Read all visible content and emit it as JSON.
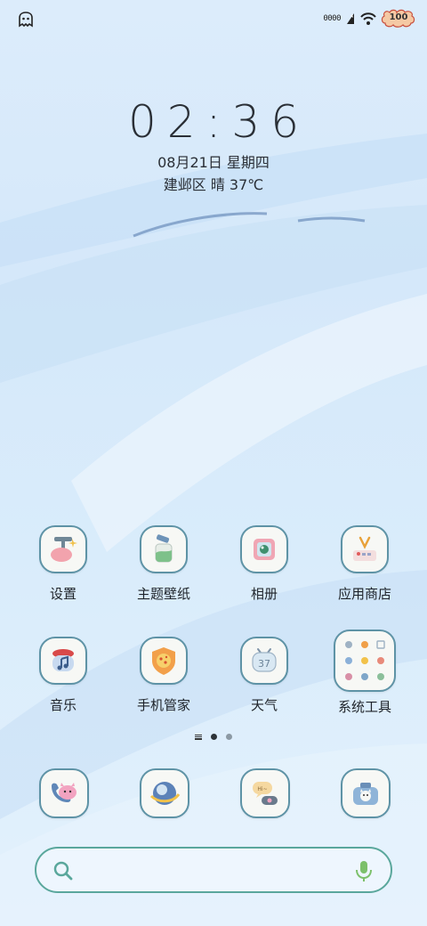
{
  "status_bar": {
    "network_speed": "0000",
    "battery_level": "100",
    "icons": [
      "notification-ghost-icon",
      "signal-icon",
      "wifi-icon",
      "battery-icon"
    ]
  },
  "lock": {
    "time": "02:36",
    "date": "08月21日 星期四",
    "weather": "建邺区 晴 37℃"
  },
  "apps": [
    {
      "label": "设置",
      "icon": "settings-app-icon"
    },
    {
      "label": "主题壁纸",
      "icon": "theme-wallpaper-app-icon"
    },
    {
      "label": "相册",
      "icon": "gallery-app-icon"
    },
    {
      "label": "应用商店",
      "icon": "app-store-icon"
    },
    {
      "label": "音乐",
      "icon": "music-app-icon"
    },
    {
      "label": "手机管家",
      "icon": "phone-manager-app-icon"
    },
    {
      "label": "天气",
      "icon": "weather-app-icon"
    },
    {
      "label": "系统工具",
      "icon": "system-tools-folder-icon"
    }
  ],
  "weather_icon_text": "37",
  "page_indicator": {
    "pages": 2,
    "current": 1
  },
  "dock": [
    {
      "icon": "phone-app-icon"
    },
    {
      "icon": "browser-app-icon"
    },
    {
      "icon": "messages-app-icon"
    },
    {
      "icon": "camera-app-icon"
    }
  ],
  "search": {
    "icons": [
      "search-icon",
      "microphone-icon"
    ]
  },
  "colors": {
    "icon_border": "#5e93a6",
    "search_border": "#5aa79c",
    "text": "#2a2f36"
  }
}
